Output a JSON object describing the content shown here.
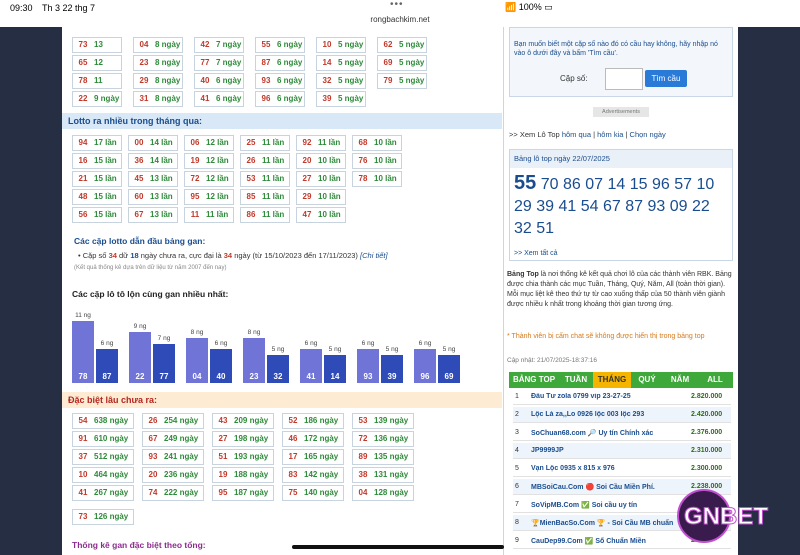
{
  "status": {
    "time": "09:30",
    "date": "Th 3 22 thg 7",
    "battery": "100%"
  },
  "url": "rongbachkim.net",
  "top_grid": [
    [
      [
        "73",
        "13 ngày"
      ],
      [
        "04",
        "8 ngày"
      ],
      [
        "42",
        "7 ngày"
      ],
      [
        "55",
        "6 ngày"
      ],
      [
        "10",
        "5 ngày"
      ],
      [
        "62",
        "5 ngày"
      ]
    ],
    [
      [
        "65",
        "12 ngày"
      ],
      [
        "23",
        "8 ngày"
      ],
      [
        "77",
        "7 ngày"
      ],
      [
        "87",
        "6 ngày"
      ],
      [
        "14",
        "5 ngày"
      ],
      [
        "69",
        "5 ngày"
      ]
    ],
    [
      [
        "78",
        "11 ngày"
      ],
      [
        "29",
        "8 ngày"
      ],
      [
        "40",
        "6 ngày"
      ],
      [
        "93",
        "6 ngày"
      ],
      [
        "32",
        "5 ngày"
      ],
      [
        "79",
        "5 ngày"
      ]
    ],
    [
      [
        "22",
        "9 ngày"
      ],
      [
        "31",
        "8 ngày"
      ],
      [
        "41",
        "6 ngày"
      ],
      [
        "96",
        "6 ngày"
      ],
      [
        "39",
        "5 ngày"
      ]
    ]
  ],
  "loto_month_title": "Lotto ra nhiều trong tháng qua:",
  "loto_month": [
    [
      [
        "94",
        "17 lần"
      ],
      [
        "00",
        "14 lần"
      ],
      [
        "06",
        "12 lần"
      ],
      [
        "25",
        "11 lần"
      ],
      [
        "92",
        "11 lần"
      ],
      [
        "68",
        "10 lần"
      ]
    ],
    [
      [
        "16",
        "15 lần"
      ],
      [
        "36",
        "14 lần"
      ],
      [
        "19",
        "12 lần"
      ],
      [
        "26",
        "11 lần"
      ],
      [
        "20",
        "10 lần"
      ],
      [
        "76",
        "10 lần"
      ]
    ],
    [
      [
        "21",
        "15 lần"
      ],
      [
        "45",
        "13 lần"
      ],
      [
        "72",
        "12 lần"
      ],
      [
        "53",
        "11 lần"
      ],
      [
        "27",
        "10 lần"
      ],
      [
        "78",
        "10 lần"
      ]
    ],
    [
      [
        "48",
        "15 lần"
      ],
      [
        "60",
        "13 lần"
      ],
      [
        "95",
        "12 lần"
      ],
      [
        "85",
        "11 lần"
      ],
      [
        "29",
        "10 lần"
      ]
    ],
    [
      [
        "56",
        "15 lần"
      ],
      [
        "67",
        "13 lần"
      ],
      [
        "11",
        "11 lần"
      ],
      [
        "86",
        "11 lần"
      ],
      [
        "47",
        "10 lần"
      ]
    ]
  ],
  "pair_title": "Các cặp lotto dẫn đầu bảng gan:",
  "pair_line": {
    "pre": "Cặp số",
    "a": "34",
    "mid1": "dữ",
    "b": "18",
    "mid2": "ngày chưa ra, cực đại là",
    "c": "34",
    "post": "ngày (từ 15/10/2023 đến 17/11/2023)",
    "link": "[Chi tiết]"
  },
  "pair_note": "(Kết quả thống kê dựa trên dữ liệu từ năm 2007 đến nay)",
  "chart_title": "Các cặp lô tô lộn cùng gan nhiều nhất:",
  "chart_data": {
    "type": "bar",
    "title": "Các cặp lô tô lộn cùng gan nhiều nhất:",
    "pairs": [
      {
        "a": "78",
        "av": 11,
        "al": "11 ng",
        "b": "87",
        "bv": 6,
        "bl": "6 ng"
      },
      {
        "a": "22",
        "av": 9,
        "al": "9 ng",
        "b": "77",
        "bv": 7,
        "bl": "7 ng"
      },
      {
        "a": "04",
        "av": 8,
        "al": "8 ng",
        "b": "40",
        "bv": 6,
        "bl": "6 ng"
      },
      {
        "a": "23",
        "av": 8,
        "al": "8 ng",
        "b": "32",
        "bv": 5,
        "bl": "5 ng"
      },
      {
        "a": "41",
        "av": 6,
        "al": "6 ng",
        "b": "14",
        "bv": 5,
        "bl": "5 ng"
      },
      {
        "a": "93",
        "av": 6,
        "al": "6 ng",
        "b": "39",
        "bv": 5,
        "bl": "5 ng"
      },
      {
        "a": "96",
        "av": 6,
        "al": "6 ng",
        "b": "69",
        "bv": 5,
        "bl": "5 ng"
      }
    ],
    "ylim": [
      0,
      11
    ]
  },
  "db_title": "Đặc biệt lâu chưa ra:",
  "db_grid": [
    [
      [
        "54",
        "638 ngày"
      ],
      [
        "26",
        "254 ngày"
      ],
      [
        "43",
        "209 ngày"
      ],
      [
        "52",
        "186 ngày"
      ],
      [
        "53",
        "139 ngày"
      ]
    ],
    [
      [
        "91",
        "610 ngày"
      ],
      [
        "67",
        "249 ngày"
      ],
      [
        "27",
        "198 ngày"
      ],
      [
        "46",
        "172 ngày"
      ],
      [
        "72",
        "136 ngày"
      ]
    ],
    [
      [
        "37",
        "512 ngày"
      ],
      [
        "93",
        "241 ngày"
      ],
      [
        "51",
        "193 ngày"
      ],
      [
        "17",
        "165 ngày"
      ],
      [
        "89",
        "135 ngày"
      ]
    ],
    [
      [
        "10",
        "464 ngày"
      ],
      [
        "20",
        "236 ngày"
      ],
      [
        "19",
        "188 ngày"
      ],
      [
        "83",
        "142 ngày"
      ],
      [
        "38",
        "131 ngày"
      ]
    ],
    [
      [
        "41",
        "267 ngày"
      ],
      [
        "74",
        "222 ngày"
      ],
      [
        "95",
        "187 ngày"
      ],
      [
        "75",
        "140 ngày"
      ],
      [
        "04",
        "128 ngày"
      ]
    ],
    [
      [
        "73",
        "126 ngày"
      ]
    ]
  ],
  "gan_title": "Thống kê gan đặc biệt theo tổng:",
  "right": {
    "ask": "Bạn muốn biết một cặp số nào đó có cầu hay không, hãy nhập nó vào ô dưới đây và bấm 'Tìm cầu'.",
    "label": "Cặp số:",
    "search_btn": "Tìm cầu",
    "ad": "Advertisements",
    "xem": ">> Xem Lô Top",
    "xem_links": [
      "hôm qua",
      "hôm kia",
      "Chọn ngày"
    ],
    "top_title": "Bảng lô top ngày 22/07/2025",
    "top_first": "55",
    "top_rest": [
      "70",
      "86",
      "07",
      "14",
      "15",
      "96",
      "57",
      "10",
      "29",
      "39",
      "41",
      "54",
      "67",
      "87",
      "93",
      "09",
      "22",
      "32",
      "51"
    ],
    "xem_all": ">> Xem tất cả",
    "desc_bold": "Bảng Top",
    "desc": "là nơi thống kê kết quả chơi lô của các thành viên RBK. Bảng được chia thành các mục Tuần, Tháng, Quý, Năm, All (toàn thời gian). Mỗi mục liệt kê theo thứ tự từ cao xuống thấp của 50 thành viên giành được nhiều k nhất trong khoảng thời gian tương ứng.",
    "warn": "* Thành viên bị cấm chat sẽ không được hiển thị trong bảng top",
    "update": "Cập nhật: 21/07/2025-18:37:16",
    "tabs": [
      "BẢNG TOP",
      "TUẦN",
      "THÁNG",
      "QUÝ",
      "NĂM",
      "ALL"
    ],
    "rows": [
      [
        "1",
        "Đầu Tư zola 0799 vip 23-27-25",
        "2.820.000"
      ],
      [
        "2",
        "Lộc Lá za,,Lo 0926 lộc 003 lộc 293",
        "2.420.000"
      ],
      [
        "3",
        "SoChuan68.com 🔎 Uy tín Chính xác",
        "2.376.000"
      ],
      [
        "4",
        "JP9999JP",
        "2.310.000"
      ],
      [
        "5",
        "Vạn Lộc 0935 x 815 x 976",
        "2.300.000"
      ],
      [
        "6",
        "MBSoiCau.Com 🔴 Soi Cầu Miền Phí.",
        "2.238.000"
      ],
      [
        "7",
        "SoVipMB.Com ✅ Soi cầu uy tín",
        "2.238"
      ],
      [
        "8",
        "🏆MienBacSo.Com 🏆 - Soi Cầu MB chuẩn",
        "2.2"
      ],
      [
        "9",
        "CauDep99.Com ✅ Số Chuẩn Miền",
        "2.2"
      ]
    ]
  },
  "logo": "GNBET"
}
